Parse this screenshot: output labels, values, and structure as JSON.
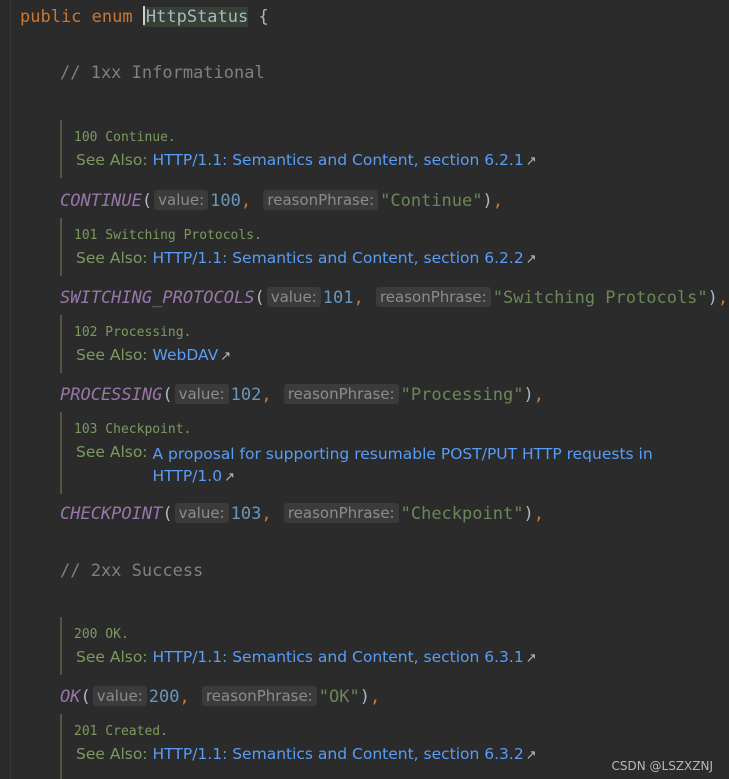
{
  "header": {
    "kw1": "public",
    "kw2": "enum",
    "class_first": "H",
    "class_rest": "ttpStatus",
    "brace": "{"
  },
  "comments": {
    "c1": "// 1xx Informational",
    "c2": "// 2xx Success"
  },
  "see_label": "See Also:",
  "hint_value": "value:",
  "hint_reason": "reasonPhrase:",
  "docs": [
    {
      "desc": "100 Continue.",
      "link": "HTTP/1.1: Semantics and Content, section 6.2.1"
    },
    {
      "desc": "101 Switching Protocols.",
      "link": "HTTP/1.1: Semantics and Content, section 6.2.2"
    },
    {
      "desc": "102 Processing.",
      "link": "WebDAV"
    },
    {
      "desc": "103 Checkpoint.",
      "link_line1": "A proposal for supporting resumable POST/PUT HTTP requests in",
      "link_line2": "HTTP/1.0"
    },
    {
      "desc": "200 OK.",
      "link": "HTTP/1.1: Semantics and Content, section 6.3.1"
    },
    {
      "desc": "201 Created.",
      "link": "HTTP/1.1: Semantics and Content, section 6.3.2"
    }
  ],
  "constants": [
    {
      "name": "CONTINUE",
      "value": "100",
      "reason": "\"Continue\"",
      "end": "),"
    },
    {
      "name": "SWITCHING_PROTOCOLS",
      "value": "101",
      "reason": "\"Switching Protocols\"",
      "end": "),"
    },
    {
      "name": "PROCESSING",
      "value": "102",
      "reason": "\"Processing\"",
      "end": "),"
    },
    {
      "name": "CHECKPOINT",
      "value": "103",
      "reason": "\"Checkpoint\"",
      "end": "),"
    },
    {
      "name": "OK",
      "value": "200",
      "reason": "\"OK\"",
      "end": "),"
    }
  ],
  "watermark": "CSDN @LSZXZNJ"
}
